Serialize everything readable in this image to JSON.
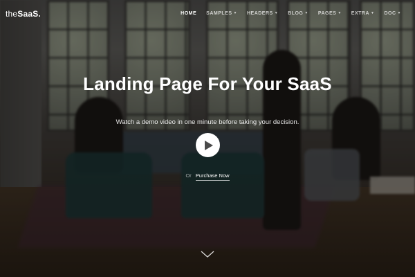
{
  "logo": {
    "prefix": "the",
    "name": "SaaS."
  },
  "nav": {
    "items": [
      {
        "label": "HOME",
        "active": true,
        "dropdown": false
      },
      {
        "label": "SAMPLES",
        "active": false,
        "dropdown": true
      },
      {
        "label": "HEADERS",
        "active": false,
        "dropdown": true
      },
      {
        "label": "BLOG",
        "active": false,
        "dropdown": true
      },
      {
        "label": "PAGES",
        "active": false,
        "dropdown": true
      },
      {
        "label": "EXTRA",
        "active": false,
        "dropdown": true
      },
      {
        "label": "DOC",
        "active": false,
        "dropdown": true
      }
    ]
  },
  "hero": {
    "title": "Landing Page For Your SaaS",
    "subtitle": "Watch a demo video in one minute before taking your decision.",
    "play_icon": "play-icon",
    "or_text": "Or",
    "purchase_label": "Purchase Now",
    "scroll_icon": "chevron-down-icon"
  },
  "colors": {
    "overlay": "rgba(0,0,0,0.42)",
    "text": "#ffffff",
    "play_bg": "#ffffff",
    "play_icon": "#4a4a4a"
  }
}
